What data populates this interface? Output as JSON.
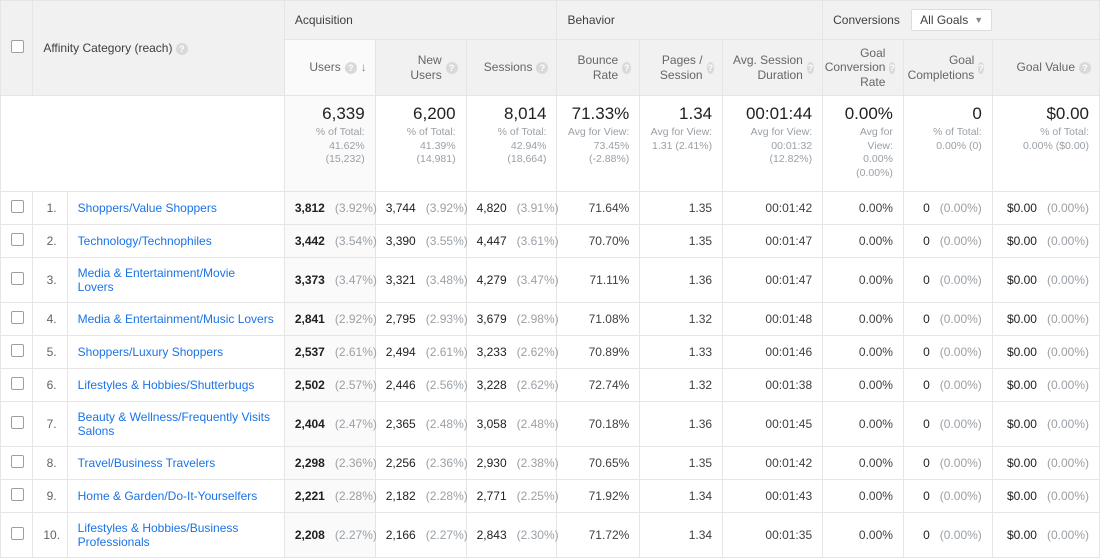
{
  "primary_dimension_label": "Affinity Category (reach)",
  "groups": {
    "acquisition": "Acquisition",
    "behavior": "Behavior",
    "conversions": "Conversions"
  },
  "conversions_selector": "All Goals",
  "columns": {
    "users": "Users",
    "new_users": "New Users",
    "sessions": "Sessions",
    "bounce_rate": "Bounce Rate",
    "pages_session": "Pages / Session",
    "avg_duration": "Avg. Session Duration",
    "goal_conv_rate": "Goal Conversion Rate",
    "goal_completions": "Goal Completions",
    "goal_value": "Goal Value"
  },
  "summary": {
    "users": {
      "value": "6,339",
      "sub1": "% of Total:",
      "sub2": "41.62% (15,232)"
    },
    "new_users": {
      "value": "6,200",
      "sub1": "% of Total:",
      "sub2": "41.39% (14,981)"
    },
    "sessions": {
      "value": "8,014",
      "sub1": "% of Total:",
      "sub2": "42.94% (18,664)"
    },
    "bounce_rate": {
      "value": "71.33%",
      "sub1": "Avg for View:",
      "sub2": "73.45%",
      "sub3": "(-2.88%)"
    },
    "pages_session": {
      "value": "1.34",
      "sub1": "Avg for View:",
      "sub2": "1.31 (2.41%)"
    },
    "avg_duration": {
      "value": "00:01:44",
      "sub1": "Avg for View:",
      "sub2": "00:01:32",
      "sub3": "(12.82%)"
    },
    "goal_conv_rate": {
      "value": "0.00%",
      "sub1": "Avg for View:",
      "sub2": "0.00% (0.00%)"
    },
    "goal_completions": {
      "value": "0",
      "sub1": "% of Total:",
      "sub2": "0.00% (0)"
    },
    "goal_value": {
      "value": "$0.00",
      "sub1": "% of Total:",
      "sub2": "0.00% ($0.00)"
    }
  },
  "rows": [
    {
      "idx": "1.",
      "category": "Shoppers/Value Shoppers",
      "users": "3,812",
      "users_pct": "(3.92%)",
      "new_users": "3,744",
      "new_users_pct": "(3.92%)",
      "sessions": "4,820",
      "sessions_pct": "(3.91%)",
      "bounce": "71.64%",
      "pps": "1.35",
      "dur": "00:01:42",
      "gcr": "0.00%",
      "gc": "0",
      "gc_pct": "(0.00%)",
      "gv": "$0.00",
      "gv_pct": "(0.00%)"
    },
    {
      "idx": "2.",
      "category": "Technology/Technophiles",
      "users": "3,442",
      "users_pct": "(3.54%)",
      "new_users": "3,390",
      "new_users_pct": "(3.55%)",
      "sessions": "4,447",
      "sessions_pct": "(3.61%)",
      "bounce": "70.70%",
      "pps": "1.35",
      "dur": "00:01:47",
      "gcr": "0.00%",
      "gc": "0",
      "gc_pct": "(0.00%)",
      "gv": "$0.00",
      "gv_pct": "(0.00%)"
    },
    {
      "idx": "3.",
      "category": "Media & Entertainment/Movie Lovers",
      "users": "3,373",
      "users_pct": "(3.47%)",
      "new_users": "3,321",
      "new_users_pct": "(3.48%)",
      "sessions": "4,279",
      "sessions_pct": "(3.47%)",
      "bounce": "71.11%",
      "pps": "1.36",
      "dur": "00:01:47",
      "gcr": "0.00%",
      "gc": "0",
      "gc_pct": "(0.00%)",
      "gv": "$0.00",
      "gv_pct": "(0.00%)"
    },
    {
      "idx": "4.",
      "category": "Media & Entertainment/Music Lovers",
      "users": "2,841",
      "users_pct": "(2.92%)",
      "new_users": "2,795",
      "new_users_pct": "(2.93%)",
      "sessions": "3,679",
      "sessions_pct": "(2.98%)",
      "bounce": "71.08%",
      "pps": "1.32",
      "dur": "00:01:48",
      "gcr": "0.00%",
      "gc": "0",
      "gc_pct": "(0.00%)",
      "gv": "$0.00",
      "gv_pct": "(0.00%)"
    },
    {
      "idx": "5.",
      "category": "Shoppers/Luxury Shoppers",
      "users": "2,537",
      "users_pct": "(2.61%)",
      "new_users": "2,494",
      "new_users_pct": "(2.61%)",
      "sessions": "3,233",
      "sessions_pct": "(2.62%)",
      "bounce": "70.89%",
      "pps": "1.33",
      "dur": "00:01:46",
      "gcr": "0.00%",
      "gc": "0",
      "gc_pct": "(0.00%)",
      "gv": "$0.00",
      "gv_pct": "(0.00%)"
    },
    {
      "idx": "6.",
      "category": "Lifestyles & Hobbies/Shutterbugs",
      "users": "2,502",
      "users_pct": "(2.57%)",
      "new_users": "2,446",
      "new_users_pct": "(2.56%)",
      "sessions": "3,228",
      "sessions_pct": "(2.62%)",
      "bounce": "72.74%",
      "pps": "1.32",
      "dur": "00:01:38",
      "gcr": "0.00%",
      "gc": "0",
      "gc_pct": "(0.00%)",
      "gv": "$0.00",
      "gv_pct": "(0.00%)"
    },
    {
      "idx": "7.",
      "category": "Beauty & Wellness/Frequently Visits Salons",
      "users": "2,404",
      "users_pct": "(2.47%)",
      "new_users": "2,365",
      "new_users_pct": "(2.48%)",
      "sessions": "3,058",
      "sessions_pct": "(2.48%)",
      "bounce": "70.18%",
      "pps": "1.36",
      "dur": "00:01:45",
      "gcr": "0.00%",
      "gc": "0",
      "gc_pct": "(0.00%)",
      "gv": "$0.00",
      "gv_pct": "(0.00%)"
    },
    {
      "idx": "8.",
      "category": "Travel/Business Travelers",
      "users": "2,298",
      "users_pct": "(2.36%)",
      "new_users": "2,256",
      "new_users_pct": "(2.36%)",
      "sessions": "2,930",
      "sessions_pct": "(2.38%)",
      "bounce": "70.65%",
      "pps": "1.35",
      "dur": "00:01:42",
      "gcr": "0.00%",
      "gc": "0",
      "gc_pct": "(0.00%)",
      "gv": "$0.00",
      "gv_pct": "(0.00%)"
    },
    {
      "idx": "9.",
      "category": "Home & Garden/Do-It-Yourselfers",
      "users": "2,221",
      "users_pct": "(2.28%)",
      "new_users": "2,182",
      "new_users_pct": "(2.28%)",
      "sessions": "2,771",
      "sessions_pct": "(2.25%)",
      "bounce": "71.92%",
      "pps": "1.34",
      "dur": "00:01:43",
      "gcr": "0.00%",
      "gc": "0",
      "gc_pct": "(0.00%)",
      "gv": "$0.00",
      "gv_pct": "(0.00%)"
    },
    {
      "idx": "10.",
      "category": "Lifestyles & Hobbies/Business Professionals",
      "users": "2,208",
      "users_pct": "(2.27%)",
      "new_users": "2,166",
      "new_users_pct": "(2.27%)",
      "sessions": "2,843",
      "sessions_pct": "(2.30%)",
      "bounce": "71.72%",
      "pps": "1.34",
      "dur": "00:01:35",
      "gcr": "0.00%",
      "gc": "0",
      "gc_pct": "(0.00%)",
      "gv": "$0.00",
      "gv_pct": "(0.00%)"
    }
  ]
}
